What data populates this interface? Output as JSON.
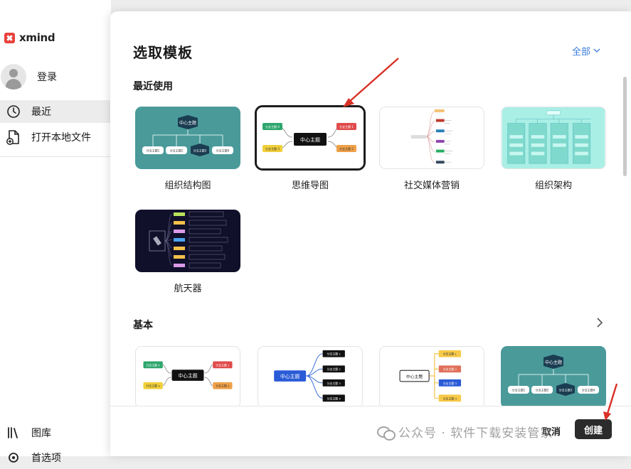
{
  "app": {
    "name": "xmind"
  },
  "sidebar": {
    "login_label": "登录",
    "items": [
      {
        "label": "最近",
        "icon": "clock-icon",
        "active": true
      },
      {
        "label": "打开本地文件",
        "icon": "file-add-icon",
        "active": false
      }
    ],
    "bottom_items": [
      {
        "label": "图库",
        "icon": "library-icon"
      },
      {
        "label": "首选项",
        "icon": "gear-icon"
      }
    ]
  },
  "dialog": {
    "title": "选取模板",
    "filter_label": "全部",
    "recent_section": "最近使用",
    "basic_section": "基本",
    "recent_templates": [
      {
        "label": "组织结构图"
      },
      {
        "label": "思维导图"
      },
      {
        "label": "社交媒体营销"
      },
      {
        "label": "组织架构"
      },
      {
        "label": "航天器"
      }
    ],
    "thumb_text": {
      "center": "中心主题",
      "b1": "分支主题 1",
      "b2": "分支主题 2",
      "b3": "分支主题 3",
      "b4": "分支主题 4",
      "b1n": "分支主题1",
      "b2n": "分支主题2",
      "b3n": "分支主题3",
      "b4n": "分支主题4"
    },
    "cancel_label": "取消",
    "create_label": "创建"
  },
  "watermark": "公众号 · 软件下载安装管家",
  "colors": {
    "teal": "#4a9a9a",
    "navy": "#10102a",
    "accent_blue": "#3b7ddd",
    "arrow_red": "#d93025"
  }
}
